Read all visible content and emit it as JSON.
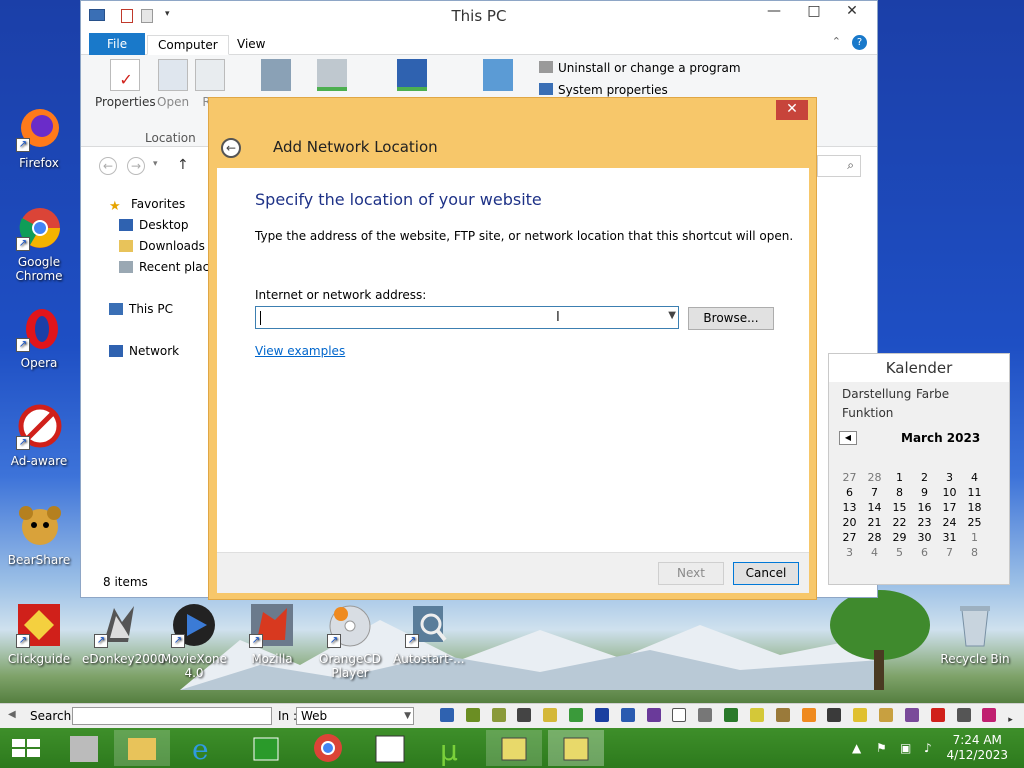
{
  "desktop": {
    "icons": [
      {
        "label": "Firefox"
      },
      {
        "label": "Google Chrome"
      },
      {
        "label": "Opera"
      },
      {
        "label": "Ad-aware"
      },
      {
        "label": "BearShare"
      },
      {
        "label": "Clickguide"
      },
      {
        "label": "eDonkey2000"
      },
      {
        "label": "MovieXone 4.0"
      },
      {
        "label": "Mozilla"
      },
      {
        "label": "OrangeCD Player"
      },
      {
        "label": "Autostart-..."
      },
      {
        "label": "Recycle Bin"
      }
    ]
  },
  "explorer": {
    "title": "This PC",
    "tabs": {
      "file": "File",
      "computer": "Computer",
      "view": "View"
    },
    "ribbon": {
      "properties": "Properties",
      "open": "Open",
      "rename": "Re",
      "location_group": "Location",
      "uninstall": "Uninstall or change a program",
      "system_properties": "System properties"
    },
    "nav": {
      "favorites": "Favorites",
      "desktop": "Desktop",
      "downloads": "Downloads",
      "recent": "Recent places",
      "this_pc": "This PC",
      "network": "Network"
    },
    "status": "8 items"
  },
  "dialog": {
    "title": "Add Network Location",
    "heading": "Specify the location of your website",
    "description": "Type the address of the website, FTP site, or network location that this shortcut will open.",
    "address_label": "Internet or network address:",
    "address_value": "",
    "browse": "Browse...",
    "view_examples": "View examples",
    "next": "Next",
    "cancel": "Cancel"
  },
  "calendar": {
    "title": "Kalender",
    "menu": {
      "darstellung": "Darstellung",
      "farbe": "Farbe",
      "funktion": "Funktion"
    },
    "month": "March 2023",
    "weeks": [
      [
        "27",
        "28",
        "1",
        "2",
        "3",
        "4"
      ],
      [
        "6",
        "7",
        "8",
        "9",
        "10",
        "11"
      ],
      [
        "13",
        "14",
        "15",
        "16",
        "17",
        "18"
      ],
      [
        "20",
        "21",
        "22",
        "23",
        "24",
        "25"
      ],
      [
        "27",
        "28",
        "29",
        "30",
        "31",
        "1"
      ],
      [
        "3",
        "4",
        "5",
        "6",
        "7",
        "8"
      ]
    ]
  },
  "searchbar": {
    "search_label": "Search :",
    "in_label": "In :",
    "in_value": "Web"
  },
  "taskbar": {
    "time": "7:24 AM",
    "date": "4/12/2023"
  },
  "colors": {
    "dialog_frame": "#f7c76a",
    "taskbar": "#2d7a1d",
    "file_tab": "#1979ca",
    "heading": "#1e3287",
    "link": "#0066cc"
  }
}
